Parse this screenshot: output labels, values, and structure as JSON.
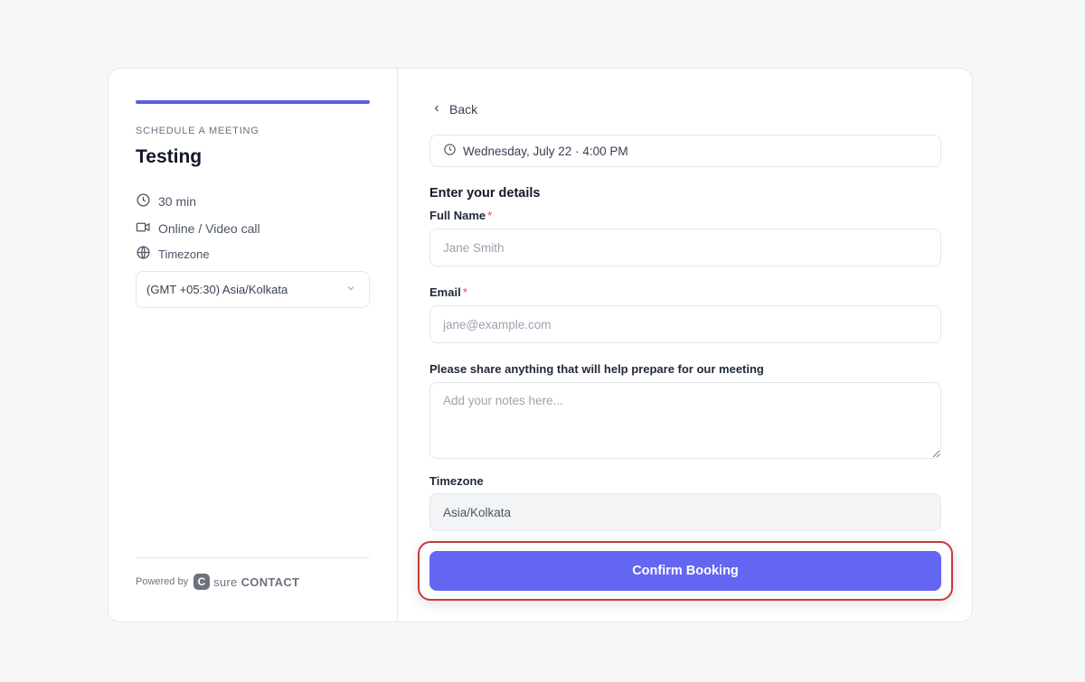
{
  "sidebar": {
    "kicker": "SCHEDULE A MEETING",
    "title": "Testing",
    "duration": "30 min",
    "location": "Online / Video call",
    "timezone_label": "Timezone",
    "timezone_value": "(GMT +05:30) Asia/Kolkata",
    "powered_by": "Powered by",
    "brand_mark": "C",
    "brand_part1": "sure",
    "brand_part2": "CONTACT"
  },
  "form": {
    "back_label": "Back",
    "selected_slot": "Wednesday, July 22 · 4:00 PM",
    "section_heading": "Enter your details",
    "full_name_label": "Full Name",
    "full_name_placeholder": "Jane Smith",
    "email_label": "Email",
    "email_placeholder": "jane@example.com",
    "notes_label": "Please share anything that will help prepare for our meeting",
    "notes_placeholder": "Add your notes here...",
    "timezone_label": "Timezone",
    "timezone_value": "Asia/Kolkata",
    "required_mark": "*",
    "submit_label": "Confirm Booking"
  },
  "colors": {
    "accent": "#6366f1",
    "progress": "#5b5fe0",
    "required": "#ef4444",
    "highlight_ring": "#c43b3b"
  },
  "icons": {
    "duration": "clock-icon",
    "location": "video-icon",
    "timezone": "globe-icon",
    "select": "chevron-down-icon",
    "back": "chevron-left-icon",
    "slot": "clock-icon",
    "brand": "surecontact-logo-icon"
  }
}
